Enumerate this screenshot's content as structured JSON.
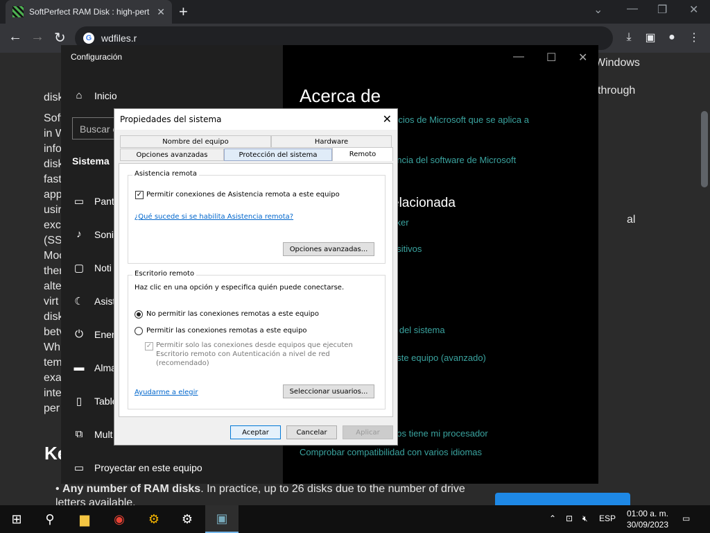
{
  "browser": {
    "tab_title": "SoftPerfect RAM Disk : high-pert",
    "url": "wdfiles.r"
  },
  "webpage": {
    "left_lines": [
      "disk",
      "Soft",
      "in W",
      "info",
      "disk",
      "fast",
      "app",
      "usir",
      "exc",
      "(SS",
      "Moc",
      "ther",
      "alte",
      "virt",
      "disk",
      "betv",
      "Whi",
      "tem",
      "exa",
      "inte",
      "per"
    ],
    "right_lines": [
      "Windows",
      "through",
      "al"
    ],
    "heading": "Ke",
    "bullet_bold": "Any number of RAM disks",
    "bullet_rest": ". In practice, up to 26 disks due to the number of drive letters available."
  },
  "settings": {
    "window_title": "Configuración",
    "home": "Inicio",
    "search_placeholder": "Buscar c",
    "section": "Sistema",
    "nav": [
      "Pant",
      "Soni",
      "Noti",
      "Asist",
      "Ener",
      "Alma",
      "Table",
      "Mult",
      "Proyectar en este equipo"
    ],
    "page_title": "Acerca de",
    "right_links": [
      "vicios de Microsoft que se aplica a",
      "encia del software de Microsoft",
      "cker",
      "ositivos",
      "a del sistema",
      "este equipo (avanzado)",
      "eos tiene mi procesador",
      "Comprobar compatibilidad con varios idiomas"
    ],
    "right_subheading": "elacionada"
  },
  "dialog": {
    "title": "Propiedades del sistema",
    "tabs_row1": [
      "Nombre del equipo",
      "Hardware"
    ],
    "tabs_row2": [
      "Opciones avanzadas",
      "Protección del sistema",
      "Remoto"
    ],
    "remote_assist": {
      "label": "Asistencia remota",
      "checkbox_label": "Permitir conexiones de Asistencia remota a este equipo",
      "checked": true,
      "help_link": "¿Qué sucede si se habilita Asistencia remota?",
      "advanced_button": "Opciones avanzadas..."
    },
    "remote_desktop": {
      "label": "Escritorio remoto",
      "instructions": "Haz clic en una opción y especifica quién puede conectarse.",
      "option_deny": "No permitir las conexiones remotas a este equipo",
      "option_allow": "Permitir las conexiones remotas a este equipo",
      "nla_line1": "Permitir solo las conexiones desde equipos que ejecuten",
      "nla_line2": "Escritorio remoto con Autenticación a nivel de red",
      "nla_line3": "(recomendado)",
      "help_link": "Ayudarme a elegir",
      "select_users_button": "Seleccionar usuarios..."
    },
    "buttons": {
      "ok": "Aceptar",
      "cancel": "Cancelar",
      "apply": "Aplicar"
    }
  },
  "taskbar": {
    "language": "ESP",
    "time": "01:00 a. m.",
    "date": "30/09/2023"
  }
}
